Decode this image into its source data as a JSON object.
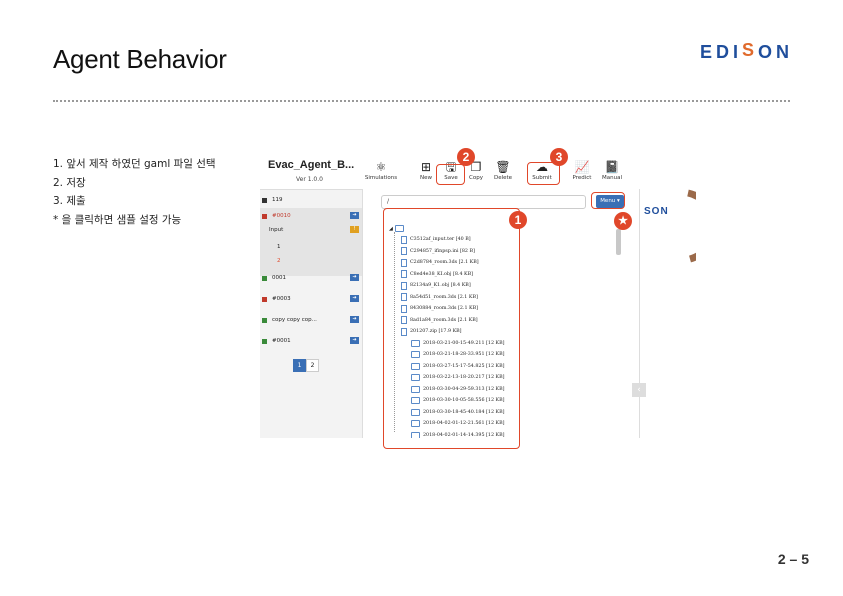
{
  "slide": {
    "title": "Agent Behavior",
    "page": "2 – 5"
  },
  "logo": {
    "text_left": "EDI",
    "text_s": "S",
    "text_right": "ON"
  },
  "instructions": [
    "1. 앞서 제작 하였던 gaml 파일 선택",
    "2. 저장",
    "3. 제출",
    "* 을 클릭하면 샘플 설정 가능"
  ],
  "app": {
    "title": "Evac_Agent_B...",
    "version": "Ver 1.0.0",
    "toolbar": [
      {
        "label": "Simulations",
        "icon": "simulations-icon"
      },
      {
        "label": "New",
        "icon": "new-icon"
      },
      {
        "label": "Save",
        "icon": "save-icon"
      },
      {
        "label": "Copy",
        "icon": "copy-icon"
      },
      {
        "label": "Delete",
        "icon": "delete-icon"
      },
      {
        "label": "Submit",
        "icon": "cloud-upload-icon"
      },
      {
        "label": "Predict",
        "icon": "predict-icon"
      },
      {
        "label": "Manual",
        "icon": "book-icon"
      }
    ],
    "sidebar": {
      "count": "119",
      "items": [
        {
          "label": "#0010",
          "color": "#c0392b"
        },
        {
          "label": "Input",
          "color": ""
        },
        {
          "label": "1",
          "color": ""
        },
        {
          "label": "2",
          "color": "#e0472a"
        },
        {
          "label": "0001",
          "color": "#3a8a3a"
        },
        {
          "label": "#0003",
          "color": "#c0392b"
        },
        {
          "label": "copy copy cop...",
          "color": "#3a8a3a"
        },
        {
          "label": "#0001",
          "color": "#3a8a3a"
        }
      ],
      "pages": [
        "1",
        "2"
      ]
    },
    "main": {
      "path": "/",
      "menu_label": "Menu ▾",
      "files": [
        "C3512af_input.ter [40 B]",
        "C294857_ifinpsp.ini [82 B]",
        "C2d8784_room.3ds [2.1 KB]",
        "C8ed4e38_KI.obj [8.4 KB]",
        "82134a9_K1.obj [8.4 KB]",
        "8a54d51_room.3ds [2.1 KB]",
        "8430884_room.3ds [2.1 KB]",
        "8ad1a84_room.3ds [2.1 KB]",
        "201207.zip [17.9 KB]"
      ],
      "folders": [
        "2018-03-21-00-15-49.211 [12 KB]",
        "2018-03-21-18-28-33.951 [12 KB]",
        "2018-03-27-15-17-54.825 [12 KB]",
        "2018-03-22-13-18-20.217 [12 KB]",
        "2018-03-30-04-29-59.313 [12 KB]",
        "2018-03-30-10-05-58.556 [12 KB]",
        "2018-03-30-18-45-40.184 [12 KB]",
        "2018-04-02-01-12-21.561 [12 KB]",
        "2018-04-02-01-14-14.395 [12 KB]"
      ]
    },
    "preview": {
      "text": "SON"
    }
  },
  "callouts": {
    "one": "1",
    "two": "2",
    "three": "3",
    "star": "★"
  },
  "colors": {
    "accent": "#e0472a",
    "brand": "#1f4e9c",
    "button": "#3a6fb5"
  }
}
